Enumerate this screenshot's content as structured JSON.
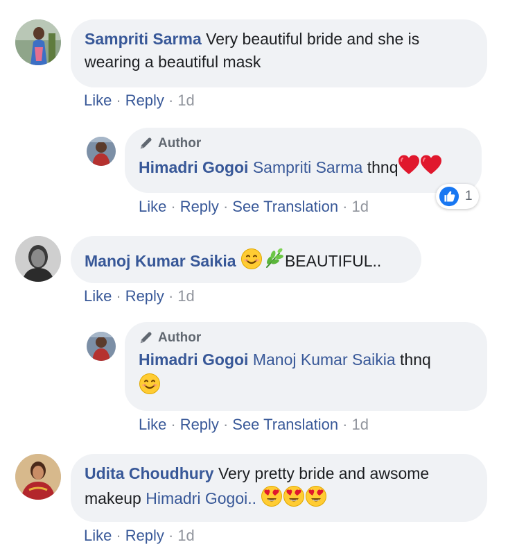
{
  "comments": [
    {
      "name": "Sampriti Sarma",
      "text_line1": "Very beautiful bride and she is",
      "text_line2": "wearing a beautiful mask",
      "actions": {
        "like": "Like",
        "reply": "Reply",
        "time": "1d"
      },
      "reply": {
        "author_badge": "Author",
        "name": "Himadri Gogoi",
        "mention": "Sampriti Sarma",
        "text": "thnq",
        "emoji": [
          "red-heart",
          "red-heart"
        ],
        "reaction_count": "1",
        "actions": {
          "like": "Like",
          "reply": "Reply",
          "translate": "See Translation",
          "time": "1d"
        }
      }
    },
    {
      "name": "Manoj Kumar Saikia",
      "emoji": [
        "smiling-face",
        "herb"
      ],
      "text": "BEAUTIFUL..",
      "actions": {
        "like": "Like",
        "reply": "Reply",
        "time": "1d"
      },
      "reply": {
        "author_badge": "Author",
        "name": "Himadri Gogoi",
        "mention": "Manoj Kumar Saikia",
        "text": "thnq",
        "emoji": [
          "smiling-face"
        ],
        "actions": {
          "like": "Like",
          "reply": "Reply",
          "translate": "See Translation",
          "time": "1d"
        }
      }
    },
    {
      "name": "Udita Choudhury",
      "text_line1": "Very pretty bride and awsome",
      "text_line2_prefix": "makeup",
      "mention": "Himadri Gogoi..",
      "emoji": [
        "heart-eyes",
        "heart-eyes",
        "heart-eyes"
      ],
      "actions": {
        "like": "Like",
        "reply": "Reply",
        "time": "1d"
      }
    }
  ],
  "colors": {
    "bubble": "#f0f2f5",
    "link": "#385898",
    "meta": "#90949c",
    "heart": "#e0182d",
    "like_blue": "#1877f2"
  }
}
